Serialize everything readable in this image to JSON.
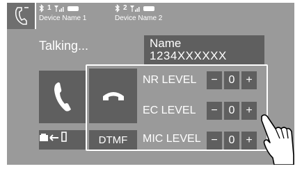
{
  "status_bar": {
    "devices": [
      {
        "slot": "1",
        "name": "Device Name 1"
      },
      {
        "slot": "2",
        "name": "Device Name 2"
      }
    ]
  },
  "call": {
    "status": "Talking...",
    "name_label": "Name",
    "number": "1234XXXXXX"
  },
  "buttons": {
    "dtmf": "DTMF"
  },
  "levels": [
    {
      "label": "NR LEVEL",
      "minus": "−",
      "value": "0",
      "plus": "+"
    },
    {
      "label": "EC LEVEL",
      "minus": "−",
      "value": "0",
      "plus": "+"
    },
    {
      "label": "MIC LEVEL",
      "minus": "−",
      "value": "0",
      "plus": "+"
    }
  ],
  "icons": {
    "phone_menu": "phone-handset-icon",
    "call": "phone-handset-icon",
    "end_call": "hang-up-icon",
    "transfer": "audio-transfer-icon",
    "touch": "pointing-hand-icon"
  },
  "colors": {
    "screen_bg": "#9a9a9a",
    "button_bg": "#5f5f5f",
    "text": "#ffffff"
  }
}
